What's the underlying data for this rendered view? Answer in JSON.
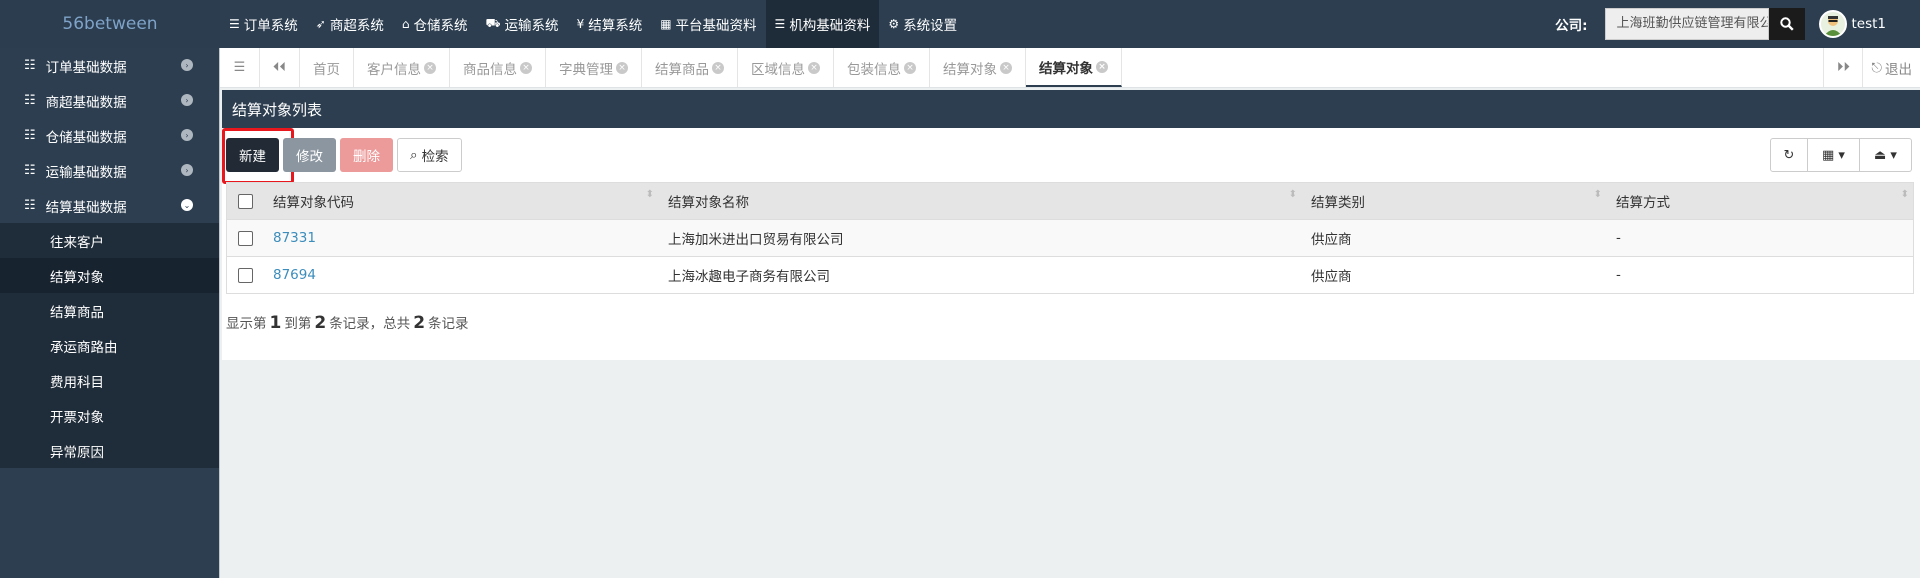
{
  "brand": "56between",
  "topnav": [
    {
      "label": "订单系统",
      "icon": "list-icon"
    },
    {
      "label": "商超系统",
      "icon": "rocket-icon"
    },
    {
      "label": "仓储系统",
      "icon": "home-icon"
    },
    {
      "label": "运输系统",
      "icon": "truck-icon"
    },
    {
      "label": "结算系统",
      "icon": "yen-icon"
    },
    {
      "label": "平台基础资料",
      "icon": "grid-icon"
    },
    {
      "label": "机构基础资料",
      "icon": "list-icon"
    },
    {
      "label": "系统设置",
      "icon": "gear-icon"
    }
  ],
  "company": {
    "label": "公司:",
    "value": "上海班勤供应链管理有限公司"
  },
  "user": {
    "name": "test1"
  },
  "sidebar": {
    "groups": [
      {
        "label": "订单基础数据"
      },
      {
        "label": "商超基础数据"
      },
      {
        "label": "仓储基础数据"
      },
      {
        "label": "运输基础数据"
      },
      {
        "label": "结算基础数据"
      }
    ],
    "sub_items": [
      {
        "label": "往来客户"
      },
      {
        "label": "结算对象"
      },
      {
        "label": "结算商品"
      },
      {
        "label": "承运商路由"
      },
      {
        "label": "费用科目"
      },
      {
        "label": "开票对象"
      },
      {
        "label": "异常原因"
      }
    ]
  },
  "tabs": [
    {
      "label": "首页"
    },
    {
      "label": "客户信息"
    },
    {
      "label": "商品信息"
    },
    {
      "label": "字典管理"
    },
    {
      "label": "结算商品"
    },
    {
      "label": "区域信息"
    },
    {
      "label": "包装信息"
    },
    {
      "label": "结算对象"
    },
    {
      "label": "结算对象"
    }
  ],
  "logout_label": "退出",
  "panel_title": "结算对象列表",
  "toolbar": {
    "new": "新建",
    "edit": "修改",
    "delete": "删除",
    "search": "检索"
  },
  "table": {
    "columns": [
      "结算对象代码",
      "结算对象名称",
      "结算类别",
      "结算方式"
    ],
    "rows": [
      {
        "code": "87331",
        "name": "上海加米进出口贸易有限公司",
        "category": "供应商",
        "method": "-"
      },
      {
        "code": "87694",
        "name": "上海冰趣电子商务有限公司",
        "category": "供应商",
        "method": "-"
      }
    ]
  },
  "pager": {
    "prefix": "显示第",
    "from": "1",
    "mid": "到第",
    "to": "2",
    "mid2": "条记录，总共",
    "total": "2",
    "suffix": "条记录"
  }
}
